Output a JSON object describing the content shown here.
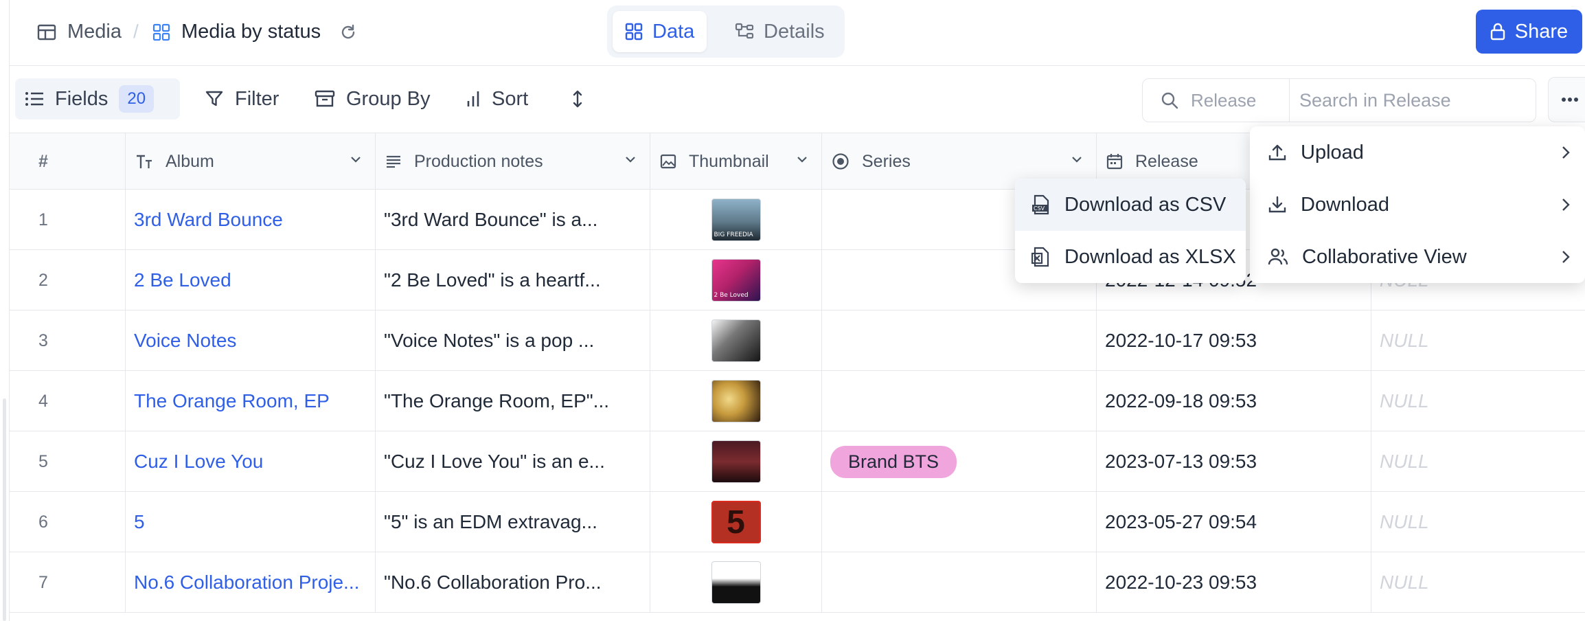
{
  "breadcrumb": {
    "root_label": "Media",
    "separator": "/",
    "view_label": "Media by status"
  },
  "view_switch": {
    "data_label": "Data",
    "details_label": "Details",
    "active": "Data"
  },
  "share_label": "Share",
  "toolbar": {
    "fields_label": "Fields",
    "fields_count": "20",
    "filter_label": "Filter",
    "group_label": "Group By",
    "sort_label": "Sort"
  },
  "search": {
    "field_label": "Release",
    "placeholder": "Search in Release"
  },
  "table": {
    "columns": {
      "num": "#",
      "album": "Album",
      "notes": "Production notes",
      "thumb": "Thumbnail",
      "series": "Series",
      "release": "Release"
    },
    "rows": [
      {
        "num": "1",
        "album": "3rd Ward Bounce",
        "notes": "\"3rd Ward Bounce\" is a...",
        "series": "",
        "release": "",
        "extra": ""
      },
      {
        "num": "2",
        "album": "2 Be Loved",
        "notes": "\"2 Be Loved\" is a heartf...",
        "series": "",
        "release": "2022-12-14 09:52",
        "extra": "NULL"
      },
      {
        "num": "3",
        "album": "Voice Notes",
        "notes": "\"Voice Notes\" is a pop ...",
        "series": "",
        "release": "2022-10-17 09:53",
        "extra": "NULL"
      },
      {
        "num": "4",
        "album": "The Orange Room, EP",
        "notes": "\"The Orange Room, EP\"...",
        "series": "",
        "release": "2022-09-18 09:53",
        "extra": "NULL"
      },
      {
        "num": "5",
        "album": "Cuz I Love You",
        "notes": "\"Cuz I Love You\" is an e...",
        "series": "Brand BTS",
        "release": "2023-07-13 09:53",
        "extra": "NULL"
      },
      {
        "num": "6",
        "album": "5",
        "notes": "\"5\" is an EDM extravag...",
        "series": "",
        "release": "2023-05-27 09:54",
        "extra": "NULL"
      },
      {
        "num": "7",
        "album": "No.6 Collaboration Proje...",
        "notes": "\"No.6 Collaboration Pro...",
        "series": "",
        "release": "2022-10-23 09:53",
        "extra": "NULL"
      }
    ]
  },
  "thumb_captions": {
    "t1": "BIG FREEDIA",
    "t2": "2 Be Loved"
  },
  "more_menu": {
    "upload_label": "Upload",
    "download_label": "Download",
    "collab_label": "Collaborative View"
  },
  "download_submenu": {
    "csv_label": "Download as CSV",
    "xlsx_label": "Download as XLSX"
  },
  "colors": {
    "accent": "#2f5fe7",
    "tag_pink": "#f0a5dd",
    "null_text": "#d1d5db"
  }
}
